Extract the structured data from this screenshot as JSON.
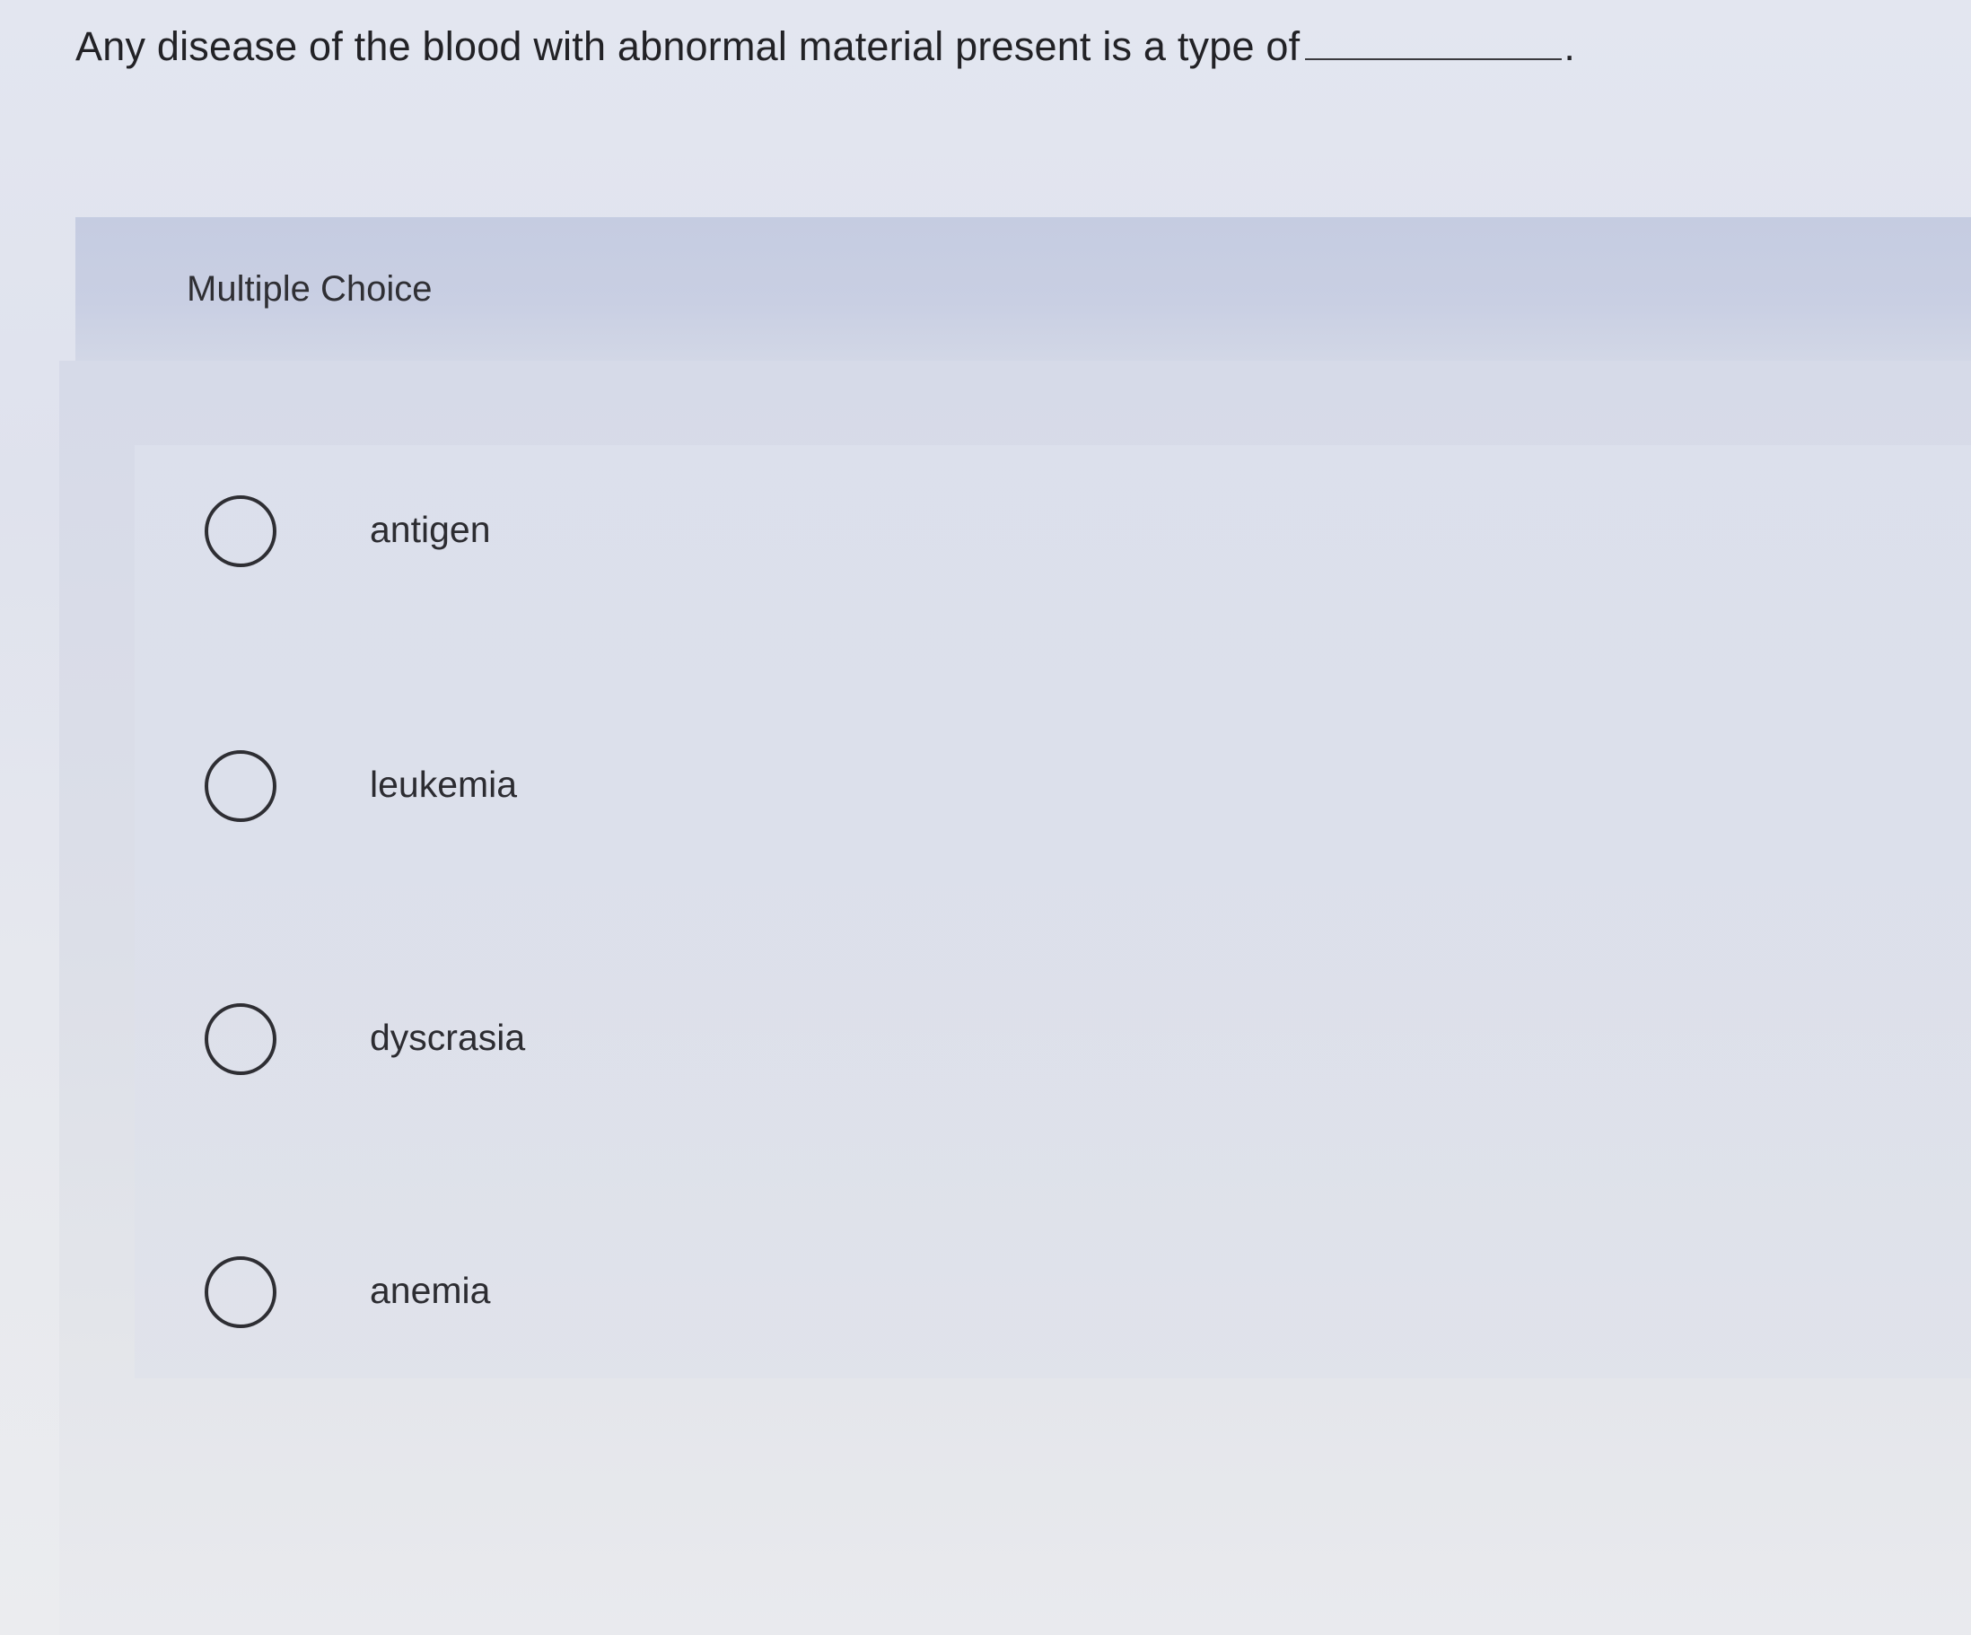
{
  "question": {
    "text": "Any disease of the blood with abnormal material present is a type of",
    "end_punctuation": "."
  },
  "section": {
    "label": "Multiple Choice"
  },
  "choices": [
    {
      "label": "antigen"
    },
    {
      "label": "leukemia"
    },
    {
      "label": "dyscrasia"
    },
    {
      "label": "anemia"
    }
  ],
  "colors": {
    "page_background": "#e3e6f0",
    "header_band": "#c8cee2",
    "text": "#222226"
  }
}
